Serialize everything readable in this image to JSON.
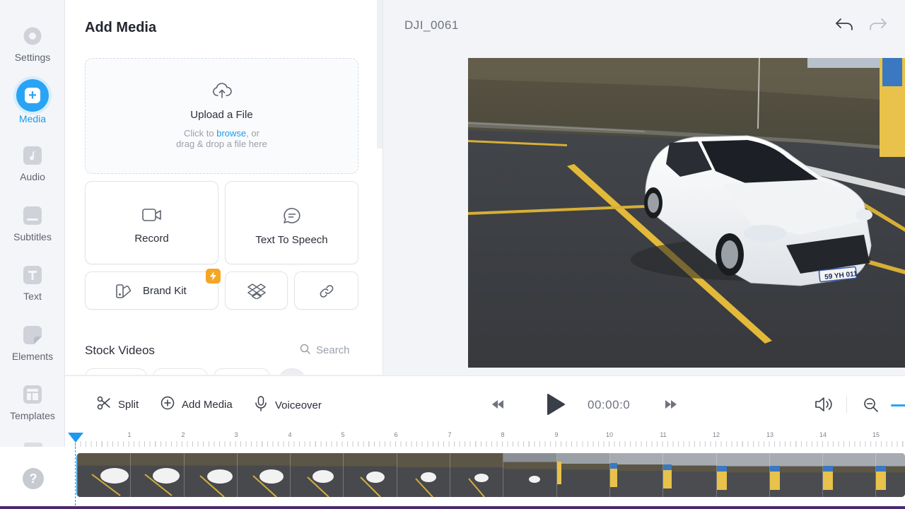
{
  "sidebar": {
    "items": [
      {
        "label": "Settings",
        "icon": "settings-icon"
      },
      {
        "label": "Media",
        "icon": "plus-icon",
        "active": true
      },
      {
        "label": "Audio",
        "icon": "music-note-icon"
      },
      {
        "label": "Subtitles",
        "icon": "subtitles-icon"
      },
      {
        "label": "Text",
        "icon": "text-icon"
      },
      {
        "label": "Elements",
        "icon": "sticker-icon"
      },
      {
        "label": "Templates",
        "icon": "template-icon"
      }
    ],
    "help_label": "?",
    "accent_color": "#29a4f5"
  },
  "panel": {
    "title": "Add Media",
    "upload": {
      "title": "Upload a File",
      "hint_prefix": "Click to ",
      "hint_link": "browse",
      "hint_suffix": ", or",
      "hint_line2": "drag & drop a file here"
    },
    "record_label": "Record",
    "tts_label": "Text To Speech",
    "brandkit_label": "Brand Kit",
    "stock_title": "Stock Videos",
    "search_placeholder": "Search"
  },
  "preview": {
    "title": "DJI_0061",
    "plate_text": "59 YH 011"
  },
  "toolbar": {
    "split_label": "Split",
    "add_media_label": "Add Media",
    "voiceover_label": "Voiceover",
    "time": "00:00:0"
  },
  "timeline": {
    "ruler": [
      "1",
      "2",
      "3",
      "4",
      "5",
      "6",
      "7",
      "8",
      "9",
      "10",
      "11",
      "12",
      "13",
      "14",
      "15"
    ]
  }
}
